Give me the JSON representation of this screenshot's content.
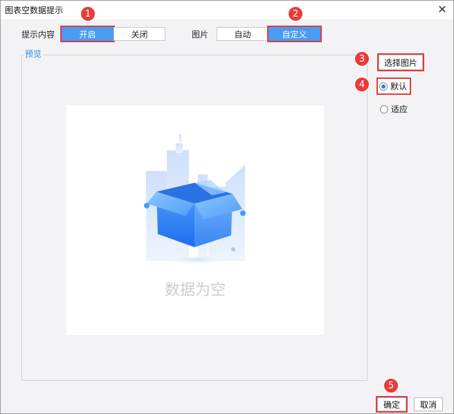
{
  "window": {
    "title": "图表空数据提示",
    "close_glyph": "✕"
  },
  "content_prompt": {
    "label": "提示内容",
    "options": [
      {
        "label": "开启",
        "selected": true
      },
      {
        "label": "关闭",
        "selected": false
      }
    ]
  },
  "picture": {
    "label": "图片",
    "options": [
      {
        "label": "自动",
        "selected": false
      },
      {
        "label": "自定义",
        "selected": true
      }
    ]
  },
  "preview": {
    "legend": "预览",
    "empty_text": "数据为空"
  },
  "side": {
    "choose_image_label": "选择图片",
    "radios": [
      {
        "label": "默认",
        "checked": true
      },
      {
        "label": "适应",
        "checked": false
      }
    ]
  },
  "footer": {
    "ok_label": "确定",
    "cancel_label": "取消"
  },
  "badges": [
    "1",
    "2",
    "3",
    "4",
    "5"
  ],
  "colors": {
    "accent": "#4a9cf2",
    "annotation": "#ea3b3b",
    "legend": "#2f8fd8"
  }
}
